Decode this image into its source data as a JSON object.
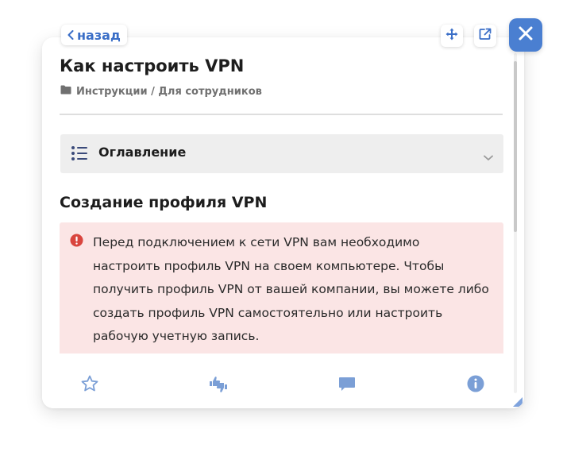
{
  "nav": {
    "back_label": "назад",
    "back_icon": "chevron-left-icon",
    "move_icon": "move-arrows-icon",
    "external_icon": "external-link-icon",
    "close_icon": "close-icon"
  },
  "article": {
    "title": "Как настроить VPN",
    "breadcrumb": "Инструкции / Для сотрудников",
    "breadcrumb_icon": "folder-icon"
  },
  "toc": {
    "label": "Оглавление",
    "icon": "list-icon",
    "expand_icon": "chevron-down-icon"
  },
  "section": {
    "heading": "Создание профиля VPN"
  },
  "alert": {
    "icon": "exclamation-circle-icon",
    "text": "Перед подключением к сети VPN вам необходимо настроить профиль VPN на своем компьютере. Чтобы получить профиль VPN от вашей компании, вы можете либо создать профиль VPN самостоятельно или настроить рабочую учетную запись."
  },
  "footer": {
    "favorite_icon": "star-icon",
    "rate_icon": "thumbs-up-down-icon",
    "comment_icon": "comment-icon",
    "info_icon": "info-icon"
  },
  "colors": {
    "accent": "#4a7fd1",
    "link": "#3a6ec7",
    "alert_background": "#fbe5e5",
    "alert_icon": "#d9453e",
    "toc_background": "#eeeeee",
    "footer_icon": "#7b9fd6"
  }
}
